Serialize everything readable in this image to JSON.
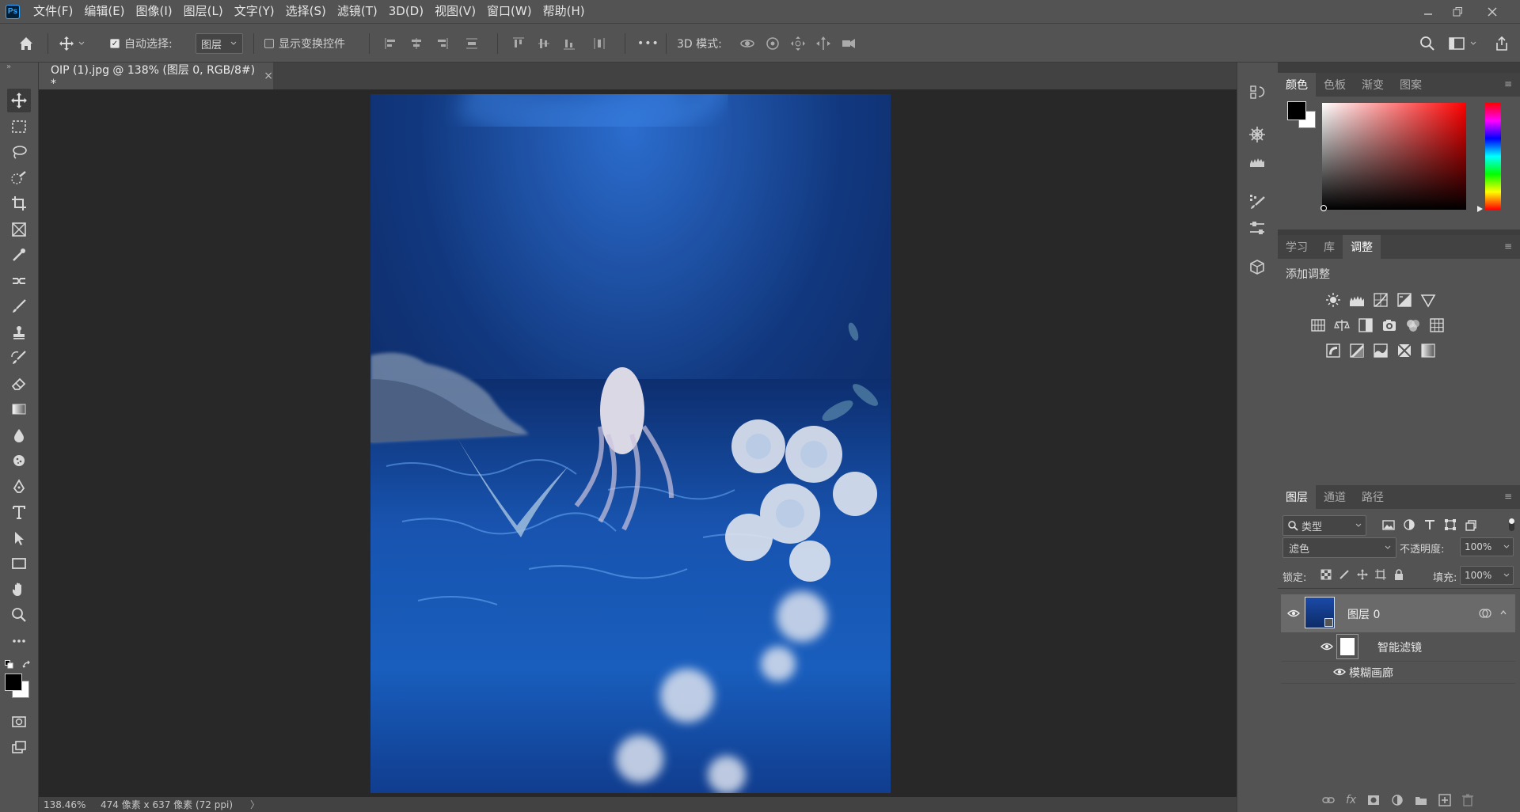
{
  "app": {
    "logo_text": "Ps",
    "menu": [
      "文件(F)",
      "编辑(E)",
      "图像(I)",
      "图层(L)",
      "文字(Y)",
      "选择(S)",
      "滤镜(T)",
      "3D(D)",
      "视图(V)",
      "窗口(W)",
      "帮助(H)"
    ]
  },
  "options": {
    "auto_select_label": "自动选择:",
    "auto_select_checked": true,
    "auto_select_target": "图层",
    "show_transform_label": "显示变换控件",
    "show_transform_checked": false,
    "more_label": "•••",
    "mode_3d_label": "3D 模式:"
  },
  "document": {
    "tab_title": "OIP (1).jpg @ 138% (图层 0, RGB/8#) *",
    "close_glyph": "×"
  },
  "status": {
    "zoom": "138.46%",
    "doc_info": "474 像素 x 637 像素 (72 ppi)",
    "arrow": "〉"
  },
  "panels": {
    "color": {
      "tabs": [
        "颜色",
        "色板",
        "渐变",
        "图案"
      ],
      "active_tab": 0,
      "foreground": "#000000",
      "background": "#ffffff",
      "hue_color": "#ff0000"
    },
    "adjustments": {
      "tabs": [
        "学习",
        "库",
        "调整"
      ],
      "active_tab": 2,
      "heading": "添加调整"
    },
    "layers": {
      "tabs": [
        "图层",
        "通道",
        "路径"
      ],
      "active_tab": 0,
      "filter_kind": "类型",
      "blend_mode": "滤色",
      "opacity_label": "不透明度:",
      "opacity_value": "100%",
      "lock_label": "锁定:",
      "fill_label": "填充:",
      "fill_value": "100%",
      "layer_name": "图层 0",
      "smart_filters_label": "智能滤镜",
      "filter_name": "模糊画廊"
    }
  },
  "colors": {
    "ui_bg": "#535353",
    "canvas_bg": "#282828",
    "accent": "#31a8ff"
  }
}
